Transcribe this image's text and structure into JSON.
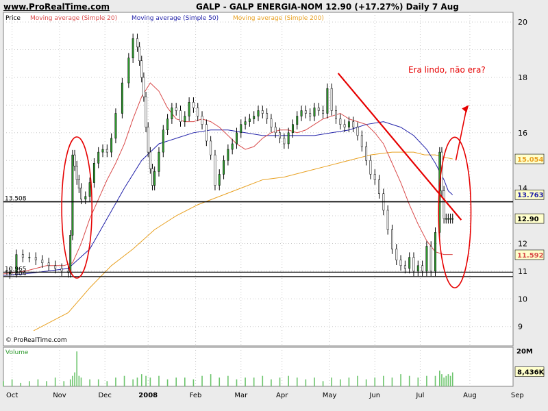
{
  "header": {
    "site": "www.ProRealTime.com",
    "title": "GALP - GALP ENERGIA-NOM    12.90 (+17.27%)    Daily  7 Aug"
  },
  "legend": {
    "price": "Price",
    "ma20": "Moving average (Simple 20)",
    "ma50": "Moving average (Simple 50)",
    "ma200": "Moving average (Simple 200)"
  },
  "colors": {
    "ma20": "#d94a4a",
    "ma50": "#1f1fa8",
    "ma200": "#e8a020",
    "candle_up": "#2f9a2f",
    "wick": "#000000",
    "trend": "#e60000",
    "volume": "#6cc46c",
    "frame": "#808080"
  },
  "copyright": "© ProRealTime.com",
  "volume_label": "Volume",
  "annotation": "Era lindo, não era?",
  "chart_data": {
    "type": "line",
    "title": "GALP - GALP ENERGIA-NOM",
    "y_scale": {
      "min": 8.3,
      "max": 20.35
    },
    "y_ticks": [
      9,
      10,
      11,
      12,
      13,
      14,
      15,
      16,
      17,
      18,
      19,
      20
    ],
    "y_tick_labels": [
      "9",
      "10",
      "11",
      "12",
      "",
      "14",
      "",
      "16",
      "",
      "18",
      "",
      "20"
    ],
    "x_range": {
      "min": 0,
      "max": 236
    },
    "x_ticks": [
      {
        "x": 4,
        "label": "Oct"
      },
      {
        "x": 26,
        "label": "Nov"
      },
      {
        "x": 47,
        "label": "Dec"
      },
      {
        "x": 67,
        "label": "2008",
        "bold": true
      },
      {
        "x": 89,
        "label": "Feb"
      },
      {
        "x": 110,
        "label": "Mar"
      },
      {
        "x": 129,
        "label": "Apr"
      },
      {
        "x": 151,
        "label": "May"
      },
      {
        "x": 172,
        "label": "Jun"
      },
      {
        "x": 193,
        "label": "Jul"
      },
      {
        "x": 216,
        "label": "Aug"
      },
      {
        "x": 238,
        "label": "Sep"
      }
    ],
    "series_price": {
      "name": "Price",
      "x": [
        0,
        4,
        8,
        12,
        16,
        20,
        24,
        28,
        31,
        33,
        34,
        35,
        36,
        38,
        40,
        42,
        44,
        46,
        48,
        50,
        52,
        55,
        58,
        60,
        62,
        64,
        66,
        67,
        68,
        69,
        70,
        72,
        74,
        76,
        78,
        80,
        82,
        84,
        86,
        88,
        90,
        92,
        94,
        96,
        98,
        100,
        102,
        104,
        106,
        108,
        110,
        112,
        114,
        116,
        118,
        120,
        122,
        124,
        126,
        128,
        130,
        132,
        134,
        136,
        138,
        140,
        142,
        144,
        146,
        148,
        150,
        152,
        154,
        156,
        158,
        160,
        162,
        164,
        166,
        168,
        170,
        172,
        174,
        176,
        178,
        180,
        182,
        184,
        186,
        188,
        190,
        192,
        194,
        196,
        198,
        200,
        202,
        204,
        206,
        208,
        210,
        212,
        214,
        216,
        218,
        219,
        220
      ],
      "values": [
        10.85,
        10.95,
        11.6,
        11.5,
        11.4,
        11.3,
        11.1,
        11.0,
        10.95,
        12.2,
        15.3,
        14.8,
        14.2,
        14.0,
        13.7,
        14.0,
        14.9,
        15.3,
        15.4,
        15.3,
        15.8,
        16.8,
        17.8,
        18.4,
        19.3,
        19.1,
        18.3,
        17.6,
        16.5,
        15.3,
        14.6,
        14.0,
        14.8,
        15.5,
        16.0,
        16.5,
        16.9,
        16.8,
        16.2,
        16.5,
        17.0,
        16.8,
        16.5,
        16.3,
        15.8,
        15.3,
        14.2,
        14.5,
        15.0,
        15.3,
        15.6,
        15.9,
        16.2,
        16.4,
        16.3,
        16.5,
        16.7,
        16.6,
        16.5,
        16.2,
        16.0,
        15.7,
        15.5,
        15.8,
        16.0,
        16.3,
        16.6,
        16.8,
        16.7,
        16.6,
        16.9,
        16.7,
        16.8,
        16.4,
        16.3,
        16.2,
        16.4,
        16.0,
        15.8,
        15.5,
        15.0,
        14.5,
        14.1,
        13.6,
        13.2,
        12.6,
        11.8,
        11.4,
        11.1,
        11.0,
        11.5,
        11.3,
        11.1,
        11.0,
        12.0,
        11.0,
        11.2,
        11.0,
        12.4,
        12.9,
        15.3,
        14.2,
        14.0,
        13.9,
        13.5,
        13.2,
        13.0
      ],
      "display_x": [
        0,
        3,
        6,
        9,
        12,
        15,
        18,
        21,
        24,
        27,
        30,
        31,
        32,
        33,
        34,
        35,
        36,
        38,
        40,
        42,
        44,
        46,
        48,
        50,
        52,
        55,
        58,
        60,
        62,
        63,
        64,
        65,
        66,
        67,
        68,
        69,
        70,
        72,
        74,
        76,
        78,
        80,
        82,
        84,
        86,
        88,
        90,
        92,
        94,
        96,
        98,
        100,
        102,
        104,
        106,
        108,
        110,
        112,
        114,
        116,
        118,
        120,
        122,
        124,
        126,
        128,
        130,
        132,
        134,
        136,
        138,
        140,
        142,
        144,
        146,
        148,
        150,
        152,
        154,
        156,
        158,
        160,
        162,
        164,
        166,
        168,
        170,
        172,
        174,
        176,
        178,
        180,
        182,
        184,
        186,
        188,
        190,
        192,
        194,
        196,
        198,
        200,
        202,
        203,
        204,
        205,
        206,
        207,
        208
      ],
      "display_values": [
        10.9,
        10.95,
        11.6,
        11.5,
        11.5,
        11.4,
        11.3,
        11.2,
        11.1,
        11.0,
        10.95,
        12.3,
        15.2,
        14.8,
        14.3,
        14.0,
        13.6,
        13.7,
        14.2,
        14.9,
        15.3,
        15.4,
        15.3,
        15.8,
        16.7,
        17.8,
        18.7,
        19.4,
        19.1,
        18.6,
        18.0,
        17.3,
        16.2,
        15.3,
        14.7,
        14.1,
        14.6,
        15.3,
        16.1,
        16.5,
        16.9,
        16.8,
        16.4,
        16.6,
        17.1,
        16.9,
        16.6,
        16.3,
        15.7,
        15.2,
        14.1,
        14.5,
        15.0,
        15.4,
        15.6,
        16.0,
        16.3,
        16.4,
        16.5,
        16.6,
        16.8,
        16.7,
        16.5,
        16.2,
        16.0,
        15.8,
        15.6,
        16.0,
        16.3,
        16.6,
        16.8,
        16.7,
        16.6,
        16.9,
        16.8,
        16.7,
        17.6,
        16.8,
        16.5,
        16.3,
        16.2,
        16.4,
        16.2,
        15.9,
        15.5,
        15.0,
        14.5,
        14.3,
        13.8,
        13.2,
        12.5,
        11.8,
        11.4,
        11.2,
        11.1,
        11.5,
        11.0,
        11.2,
        11.0,
        11.9,
        11.0,
        12.4,
        15.3,
        13.9,
        12.9,
        12.9,
        12.9,
        12.9,
        12.9
      ]
    },
    "series_ma20": {
      "name": "Moving average (Simple 20)",
      "x": [
        0,
        10,
        20,
        28,
        32,
        36,
        40,
        44,
        48,
        52,
        56,
        60,
        64,
        68,
        72,
        76,
        80,
        84,
        88,
        92,
        96,
        100,
        104,
        108,
        112,
        116,
        120,
        124,
        128,
        132,
        136,
        140,
        144,
        148,
        152,
        156,
        160,
        164,
        168,
        172,
        176,
        180,
        184,
        188,
        192,
        196,
        200,
        204,
        206,
        208
      ],
      "values": [
        10.9,
        11.0,
        11.2,
        11.2,
        11.3,
        12.0,
        12.9,
        13.6,
        14.3,
        14.9,
        15.6,
        16.5,
        17.3,
        17.8,
        17.5,
        16.9,
        16.5,
        16.4,
        16.4,
        16.5,
        16.4,
        16.2,
        15.9,
        15.6,
        15.4,
        15.5,
        15.8,
        16.0,
        16.1,
        16.1,
        16.0,
        16.1,
        16.3,
        16.5,
        16.6,
        16.7,
        16.5,
        16.4,
        16.3,
        16.0,
        15.6,
        14.9,
        14.2,
        13.4,
        12.7,
        12.1,
        11.7,
        11.6,
        11.6,
        11.6
      ]
    },
    "series_ma50": {
      "name": "Moving average (Simple 50)",
      "x": [
        0,
        10,
        20,
        30,
        40,
        48,
        56,
        64,
        72,
        80,
        88,
        96,
        104,
        112,
        120,
        128,
        136,
        144,
        152,
        160,
        168,
        176,
        184,
        190,
        196,
        200,
        204,
        206,
        208
      ],
      "values": [
        10.85,
        10.9,
        11.0,
        11.1,
        11.8,
        12.9,
        14.0,
        15.0,
        15.6,
        15.8,
        16.0,
        16.1,
        16.1,
        16.0,
        15.9,
        15.9,
        15.9,
        15.9,
        16.0,
        16.1,
        16.3,
        16.4,
        16.2,
        15.9,
        15.4,
        14.9,
        14.3,
        13.9,
        13.76
      ]
    },
    "series_ma200": {
      "name": "Moving average (Simple 200)",
      "x": [
        14,
        30,
        40,
        50,
        60,
        70,
        80,
        90,
        100,
        110,
        120,
        130,
        140,
        150,
        160,
        170,
        180,
        190,
        195,
        200,
        205,
        208
      ],
      "values": [
        8.85,
        9.5,
        10.4,
        11.2,
        11.8,
        12.5,
        13.0,
        13.4,
        13.7,
        14.0,
        14.3,
        14.4,
        14.6,
        14.8,
        15.0,
        15.2,
        15.3,
        15.3,
        15.2,
        15.2,
        15.1,
        15.054
      ]
    },
    "volume": {
      "name": "Volume",
      "scale_max": 20,
      "unit": "M",
      "last": "8,436K",
      "x": [
        0,
        4,
        8,
        12,
        16,
        20,
        24,
        28,
        31,
        32,
        33,
        34,
        35,
        36,
        40,
        44,
        48,
        52,
        56,
        60,
        62,
        64,
        66,
        68,
        72,
        76,
        80,
        84,
        88,
        92,
        96,
        100,
        104,
        108,
        112,
        116,
        120,
        124,
        128,
        132,
        136,
        140,
        144,
        148,
        152,
        156,
        160,
        164,
        168,
        172,
        176,
        180,
        184,
        188,
        192,
        196,
        200,
        202,
        203,
        204,
        205,
        206,
        207,
        208
      ],
      "values": [
        3,
        4,
        2,
        3,
        4,
        3,
        5,
        3,
        4,
        6,
        8,
        20,
        6,
        5,
        4,
        4,
        3,
        5,
        6,
        4,
        5,
        7,
        6,
        5,
        6,
        4,
        5,
        5,
        4,
        6,
        7,
        5,
        6,
        4,
        5,
        5,
        6,
        4,
        5,
        6,
        5,
        4,
        5,
        3,
        5,
        4,
        5,
        6,
        4,
        5,
        6,
        5,
        7,
        6,
        5,
        6,
        6,
        9,
        7,
        5,
        6,
        7,
        6,
        8
      ]
    },
    "hlines": [
      {
        "value": 13.508,
        "label": "13.508"
      },
      {
        "value": 10.965,
        "label": "10.965"
      },
      {
        "value": 10.804,
        "label": "10.804"
      }
    ],
    "trendline": {
      "x": [
        155,
        212
      ],
      "y": [
        18.15,
        12.85
      ]
    },
    "ellipses": [
      {
        "cx": 34,
        "cy": 13.3,
        "rx": 7,
        "ry_units": 2.55
      },
      {
        "cx": 209,
        "cy": 13.12,
        "rx": 7.5,
        "ry_units": 2.72
      }
    ],
    "last_values": [
      {
        "value": 15.054,
        "text": "15.054",
        "color": "#e8a020"
      },
      {
        "value": 13.763,
        "text": "13.763",
        "color": "#1f1fa8"
      },
      {
        "value": 12.9,
        "text": "12.90",
        "color": "#000000"
      },
      {
        "value": 11.592,
        "text": "11.592",
        "color": "#d94a4a"
      }
    ]
  }
}
